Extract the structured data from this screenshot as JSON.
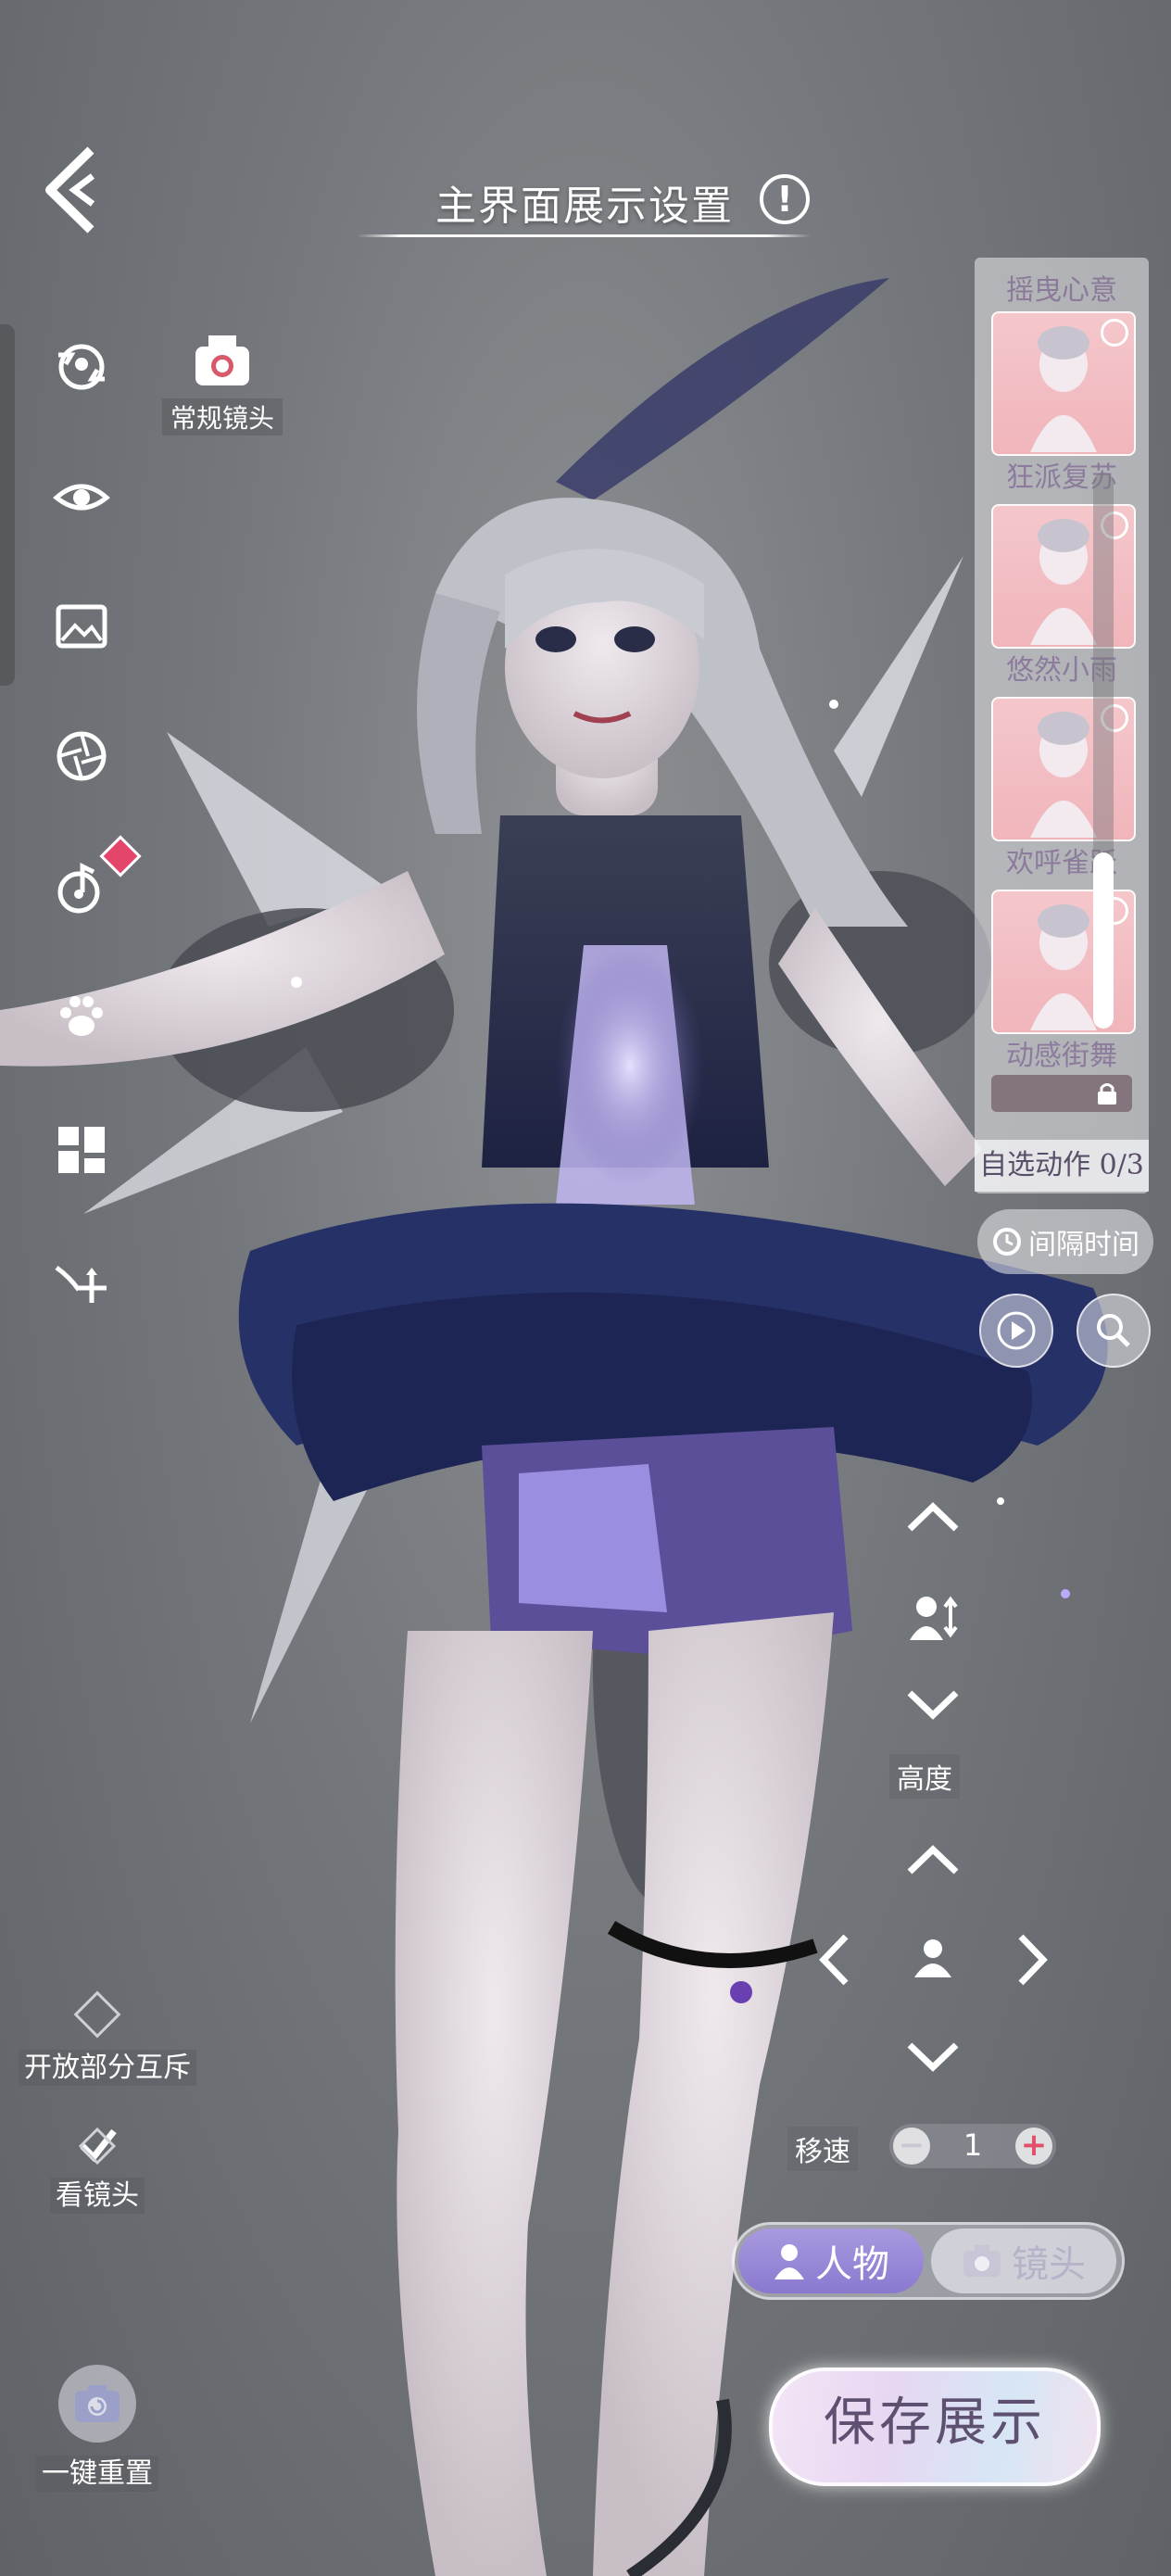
{
  "header": {
    "title": "主界面展示设置",
    "info_icon": "info-icon",
    "back_icon": "back-arrow-icon"
  },
  "left_toolbar": {
    "items": [
      {
        "name": "rotate-icon"
      },
      {
        "name": "eye-icon"
      },
      {
        "name": "image-icon"
      },
      {
        "name": "aperture-icon"
      },
      {
        "name": "music-note-icon"
      },
      {
        "name": "paw-icon"
      },
      {
        "name": "layout-icon"
      },
      {
        "name": "move-icon"
      }
    ],
    "camera_mode_label": "常规镜头"
  },
  "action_panel": {
    "title": "摇曳心意",
    "actions": [
      {
        "label": "狂派复苏"
      },
      {
        "label": "悠然小雨"
      },
      {
        "label": "欢呼雀跃"
      },
      {
        "label": "动感街舞"
      }
    ],
    "self_select": "自选动作 0/3"
  },
  "interval_button": "间隔时间",
  "height_control": {
    "label": "高度"
  },
  "move_speed": {
    "label": "移速",
    "value": "1",
    "minus": "−",
    "plus": "+"
  },
  "mode_toggle": {
    "person": "人物",
    "camera": "镜头",
    "active": "person"
  },
  "save_button": "保存展示",
  "bottom_left": {
    "partial_interact": "开放部分互斥",
    "look_camera": "看镜头",
    "reset": "一键重置"
  },
  "colors": {
    "accent": "#8a78cf",
    "panel_text": "#8c7b9c"
  }
}
